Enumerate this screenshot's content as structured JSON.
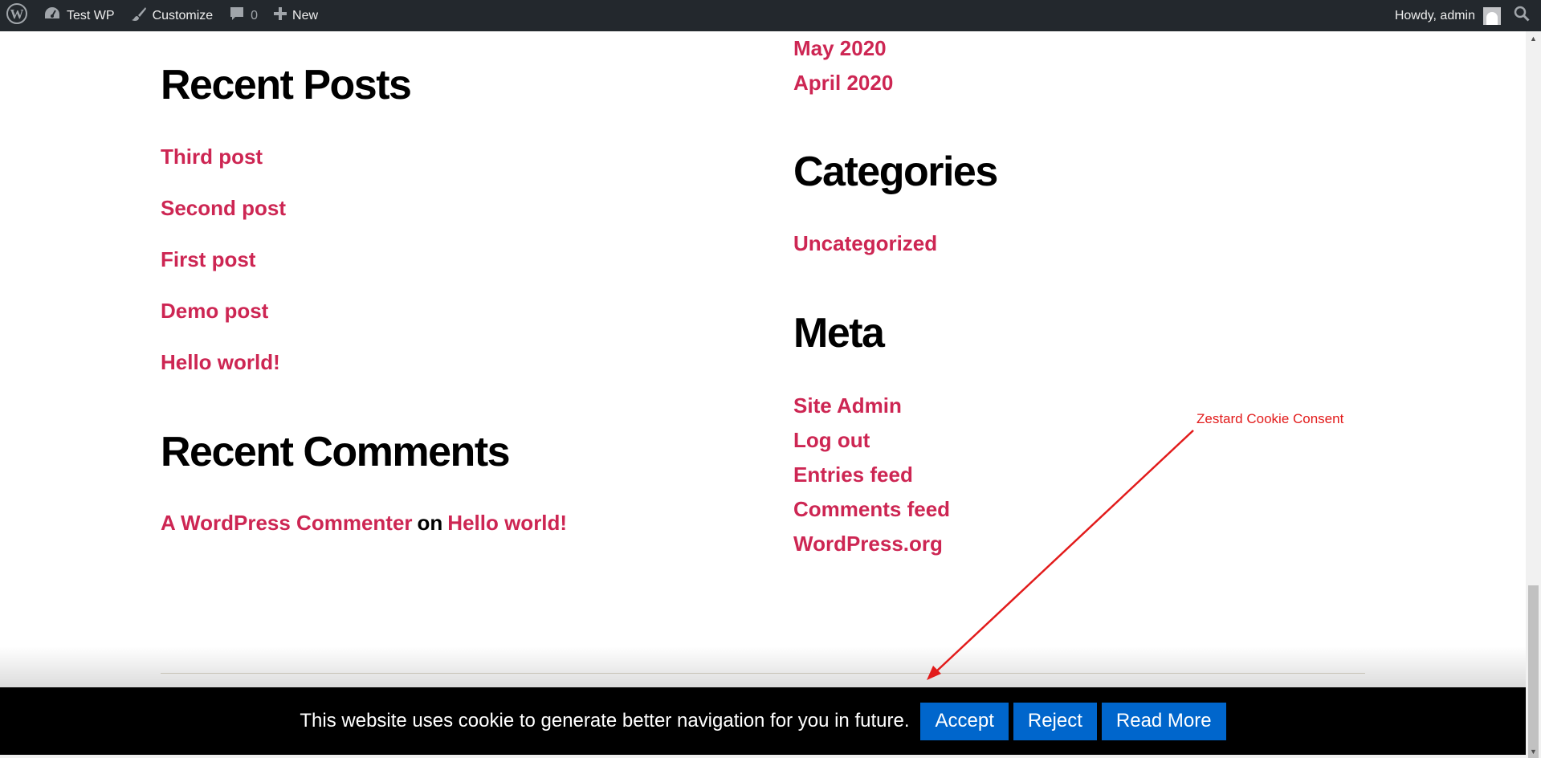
{
  "admin_bar": {
    "site_name": "Test WP",
    "customize_label": "Customize",
    "comments_count": "0",
    "new_label": "New",
    "howdy": "Howdy, admin"
  },
  "left_column": {
    "recent_posts": {
      "title": "Recent Posts",
      "items": [
        "Third post",
        "Second post",
        "First post",
        "Demo post",
        "Hello world!"
      ]
    },
    "recent_comments": {
      "title": "Recent Comments",
      "author": "A WordPress Commenter",
      "on": "on",
      "post": "Hello world!"
    }
  },
  "right_column": {
    "archives": [
      "May 2020",
      "April 2020"
    ],
    "categories": {
      "title": "Categories",
      "items": [
        "Uncategorized"
      ]
    },
    "meta": {
      "title": "Meta",
      "items": [
        "Site Admin",
        "Log out",
        "Entries feed",
        "Comments feed",
        "WordPress.org"
      ]
    }
  },
  "cookie_bar": {
    "message": "This website uses cookie to generate better navigation for you in future.",
    "accept_label": "Accept",
    "reject_label": "Reject",
    "read_more_label": "Read More"
  },
  "annotation": {
    "label": "Zestard Cookie Consent"
  },
  "colors": {
    "admin_bar_bg": "#23282d",
    "link": "#cd2653",
    "cookie_bar_bg": "#000000",
    "cookie_button": "#0066cc",
    "annotation": "#e21b1b"
  }
}
